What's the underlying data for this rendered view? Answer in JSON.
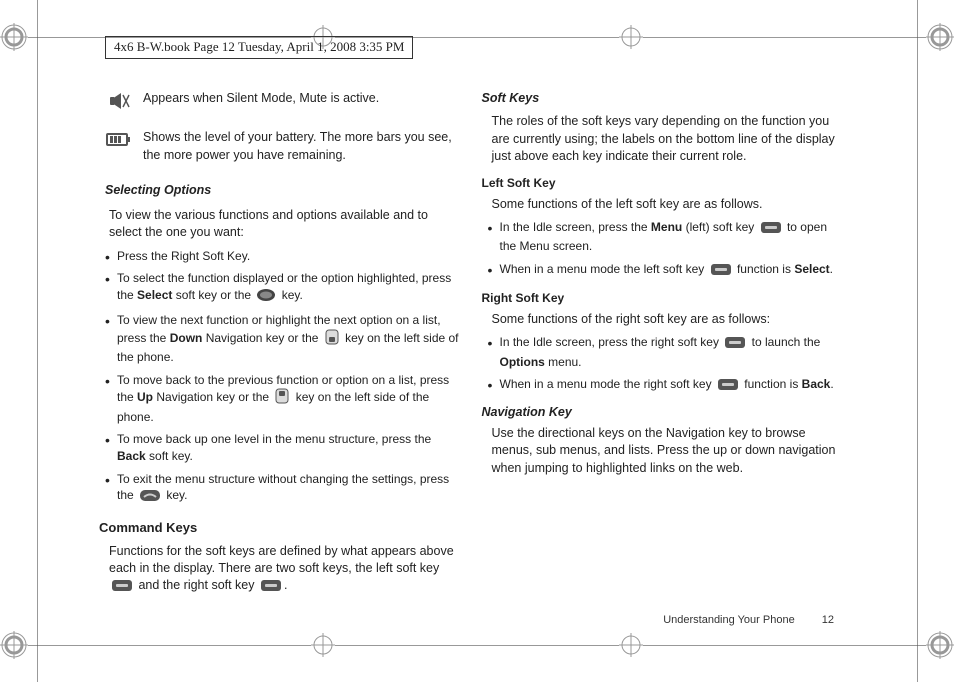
{
  "header": "4x6 B-W.book  Page 12  Tuesday, April 1, 2008  3:35 PM",
  "icons": {
    "mute": "Appears when Silent Mode, Mute  is active.",
    "battery": "Shows the level of your battery. The more bars you see, the more power you have remaining."
  },
  "selecting": {
    "title": "Selecting Options",
    "intro": "To view the various functions and options available and to select the one you want:",
    "bullets": {
      "b0": "Press the Right Soft Key.",
      "b1a": "To select the function displayed or the option highlighted, press the ",
      "b1b": "Select",
      "b1c": " soft key or the ",
      "b1d": " key.",
      "b2a": "To view the next function or highlight the next option on a list, press the ",
      "b2b": "Down",
      "b2c": " Navigation key or the  ",
      "b2d": " key on the left side of the phone.",
      "b3a": "To move back to the previous function or option on a list, press the ",
      "b3b": "Up",
      "b3c": " Navigation key or the  ",
      "b3d": " key on the left side of the phone.",
      "b4a": "To move back up one level in the menu structure, press the ",
      "b4b": "Back",
      "b4c": " soft key.",
      "b5a": "To exit the menu structure without changing the settings, press the ",
      "b5b": " key."
    }
  },
  "command": {
    "title": "Command Keys",
    "p1a": "Functions for the soft keys are defined by what appears above each in the display. There are two soft keys, the left soft key ",
    "p1b": " and the right soft key ",
    "p1c": "."
  },
  "soft": {
    "title": "Soft Keys",
    "p1": "The roles of the soft keys vary depending on the function you are currently using; the labels on the bottom line of the display just above each key indicate their current role."
  },
  "leftKey": {
    "title": "Left Soft Key",
    "intro": "Some functions of the left soft key are as follows.",
    "b1a": "In the Idle screen, press the ",
    "b1b": "Menu",
    "b1c": " (left) soft key ",
    "b1d": " to open the Menu screen.",
    "b2a": "When in a menu mode the left soft key ",
    "b2b": " function is ",
    "b2c": "Select",
    "b2d": "."
  },
  "rightKey": {
    "title": "Right Soft Key",
    "intro": "Some functions of the right soft key are as follows:",
    "b1a": "In the Idle screen, press the right soft key ",
    "b1b": " to launch the ",
    "b1c": "Options",
    "b1d": " menu.",
    "b2a": "When in a menu mode the right soft key ",
    "b2b": " function is ",
    "b2c": "Back",
    "b2d": "."
  },
  "nav": {
    "title": "Navigation Key",
    "p": "Use the directional keys on the Navigation key to browse menus, sub menus, and lists. Press the up or down navigation when jumping to highlighted links on the web."
  },
  "footer": {
    "section": "Understanding Your Phone",
    "page": "12"
  }
}
